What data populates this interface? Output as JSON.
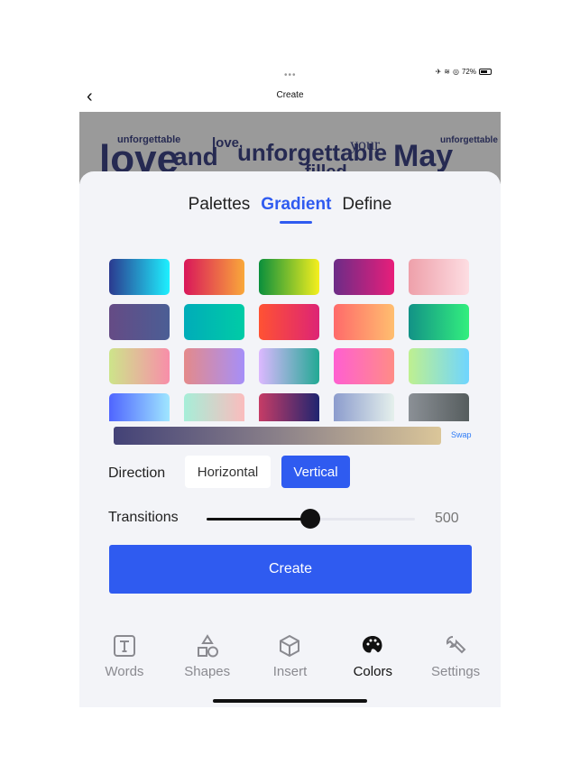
{
  "status": {
    "battery": "72%",
    "battery_level": 0.72
  },
  "header": {
    "title": "Create",
    "back_icon": "chevron-left-icon"
  },
  "preview_words": [
    "unforgettable",
    "love",
    "and",
    "love,",
    "unforgettable",
    "your",
    "May",
    "unforgettable",
    "filled"
  ],
  "tabs": [
    {
      "label": "Palettes",
      "active": false
    },
    {
      "label": "Gradient",
      "active": true
    },
    {
      "label": "Define",
      "active": false
    }
  ],
  "swatches": [
    [
      "#2b3a8f",
      "#1ef0ff"
    ],
    [
      "#d9175a",
      "#f9a83a"
    ],
    [
      "#0a8f3c",
      "#f5ef1e"
    ],
    [
      "#6c2c87",
      "#e81e7a"
    ],
    [
      "#eea0aa",
      "#fddde2"
    ],
    [
      "#654b85",
      "#4b5e95"
    ],
    [
      "#00acb9",
      "#00cca6"
    ],
    [
      "#ff5233",
      "#dd2475"
    ],
    [
      "#ff6a6a",
      "#ffbe6f"
    ],
    [
      "#129286",
      "#33ef7e"
    ],
    [
      "#cde48a",
      "#f88ea9"
    ],
    [
      "#e48a8a",
      "#a68ff8"
    ],
    [
      "#dcb8ff",
      "#22a994"
    ],
    [
      "#ff5fd1",
      "#ff8c86"
    ],
    [
      "#bff090",
      "#6fd5ff"
    ],
    [
      "#4f65ff",
      "#9fe6ff"
    ],
    [
      "#a6eed8",
      "#fbbcbd"
    ],
    [
      "#c63c66",
      "#1f2570"
    ],
    [
      "#8c9ccd",
      "#e5f0ec"
    ],
    [
      "#8b9096",
      "#565d5e"
    ]
  ],
  "current_gradient": [
    "#434277",
    "#dbc699"
  ],
  "swap_label": "Swap",
  "direction": {
    "label": "Direction",
    "options": [
      "Horizontal",
      "Vertical"
    ],
    "selected": "Vertical"
  },
  "transitions": {
    "label": "Transitions",
    "value": "500",
    "slider_fraction": 0.5
  },
  "create_label": "Create",
  "accent": "#2f5bf0",
  "nav": [
    {
      "label": "Words",
      "icon": "text-box-icon",
      "active": false
    },
    {
      "label": "Shapes",
      "icon": "shapes-icon",
      "active": false
    },
    {
      "label": "Insert",
      "icon": "cube-icon",
      "active": false
    },
    {
      "label": "Colors",
      "icon": "palette-icon",
      "active": true
    },
    {
      "label": "Settings",
      "icon": "wrench-icon",
      "active": false
    }
  ]
}
